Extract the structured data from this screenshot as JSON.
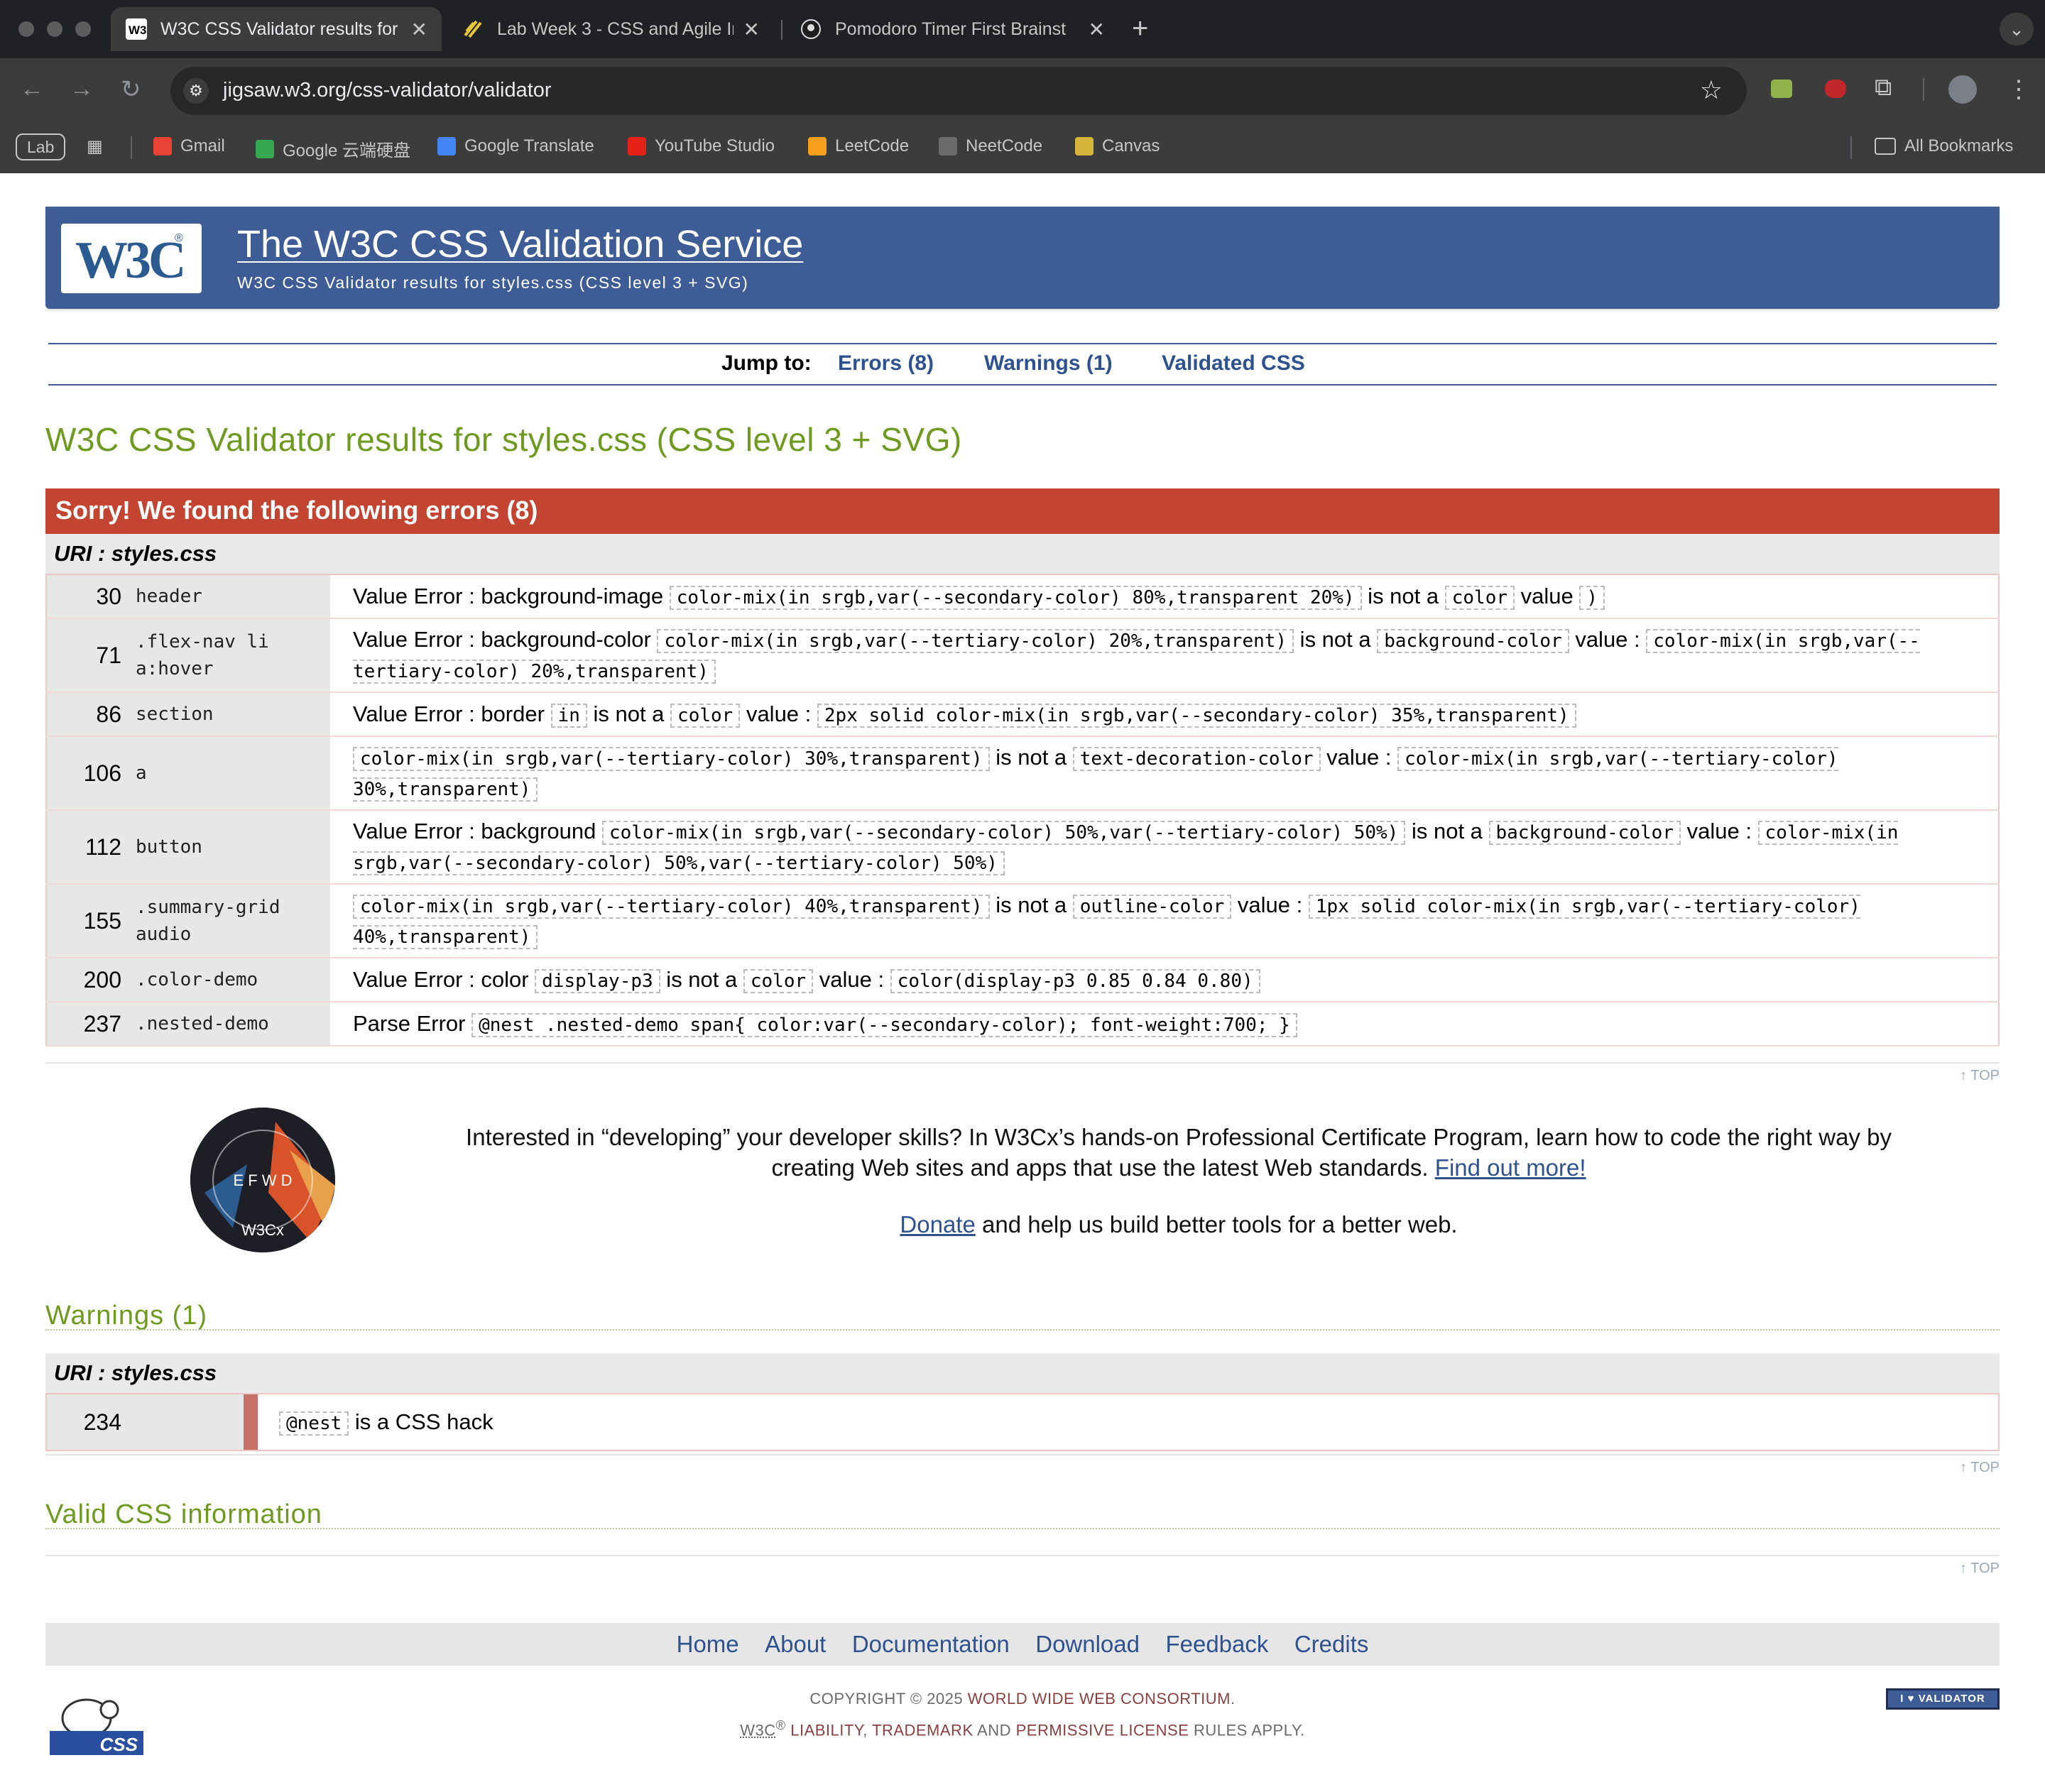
{
  "browser": {
    "tabs": [
      {
        "title": "W3C CSS Validator results for",
        "active": true
      },
      {
        "title": "Lab Week 3 - CSS and Agile In",
        "active": false
      },
      {
        "title": "Pomodoro Timer First Brainst",
        "active": false
      }
    ],
    "url": "jigsaw.w3.org/css-validator/validator",
    "bookmarks": [
      {
        "label": "Gmail"
      },
      {
        "label": "Google 云端硬盘"
      },
      {
        "label": "Google Translate"
      },
      {
        "label": "YouTube Studio"
      },
      {
        "label": "LeetCode"
      },
      {
        "label": "NeetCode"
      },
      {
        "label": "Canvas"
      }
    ],
    "profile_chip": "Lab",
    "all_bookmarks": "All Bookmarks"
  },
  "banner": {
    "logo": "W3C",
    "title": "The W3C CSS Validation Service",
    "subtitle": "W3C CSS Validator results for styles.css (CSS level 3 + SVG)"
  },
  "jump": {
    "label": "Jump to:",
    "errors": "Errors (8)",
    "warnings": "Warnings (1)",
    "validated": "Validated CSS"
  },
  "results_title": "W3C CSS Validator results for styles.css (CSS level 3 + SVG)",
  "errors": {
    "heading": "Sorry! We found the following errors (8)",
    "uri_label": "URI : styles.css",
    "rows": [
      {
        "line": "30",
        "selector": "header",
        "parts": [
          {
            "t": "Value Error : background-image "
          },
          {
            "c": "color-mix(in srgb,var(--secondary-color) 80%,transparent 20%)"
          },
          {
            "t": " is not a "
          },
          {
            "c": "color"
          },
          {
            "t": " value "
          },
          {
            "c": ")"
          }
        ]
      },
      {
        "line": "71",
        "selector": ".flex-nav li a:hover",
        "parts": [
          {
            "t": "Value Error : background-color "
          },
          {
            "c": "color-mix(in srgb,var(--tertiary-color) 20%,transparent)"
          },
          {
            "t": " is not a "
          },
          {
            "c": "background-color"
          },
          {
            "t": " value : "
          },
          {
            "c": "color-mix(in srgb,var(--tertiary-color) 20%,transparent)"
          }
        ]
      },
      {
        "line": "86",
        "selector": "section",
        "parts": [
          {
            "t": "Value Error : border "
          },
          {
            "c": "in"
          },
          {
            "t": " is not a "
          },
          {
            "c": "color"
          },
          {
            "t": " value : "
          },
          {
            "c": "2px solid color-mix(in srgb,var(--secondary-color) 35%,transparent)"
          }
        ]
      },
      {
        "line": "106",
        "selector": "a",
        "parts": [
          {
            "c": "color-mix(in srgb,var(--tertiary-color) 30%,transparent)"
          },
          {
            "t": " is not a "
          },
          {
            "c": "text-decoration-color"
          },
          {
            "t": " value : "
          },
          {
            "c": "color-mix(in srgb,var(--tertiary-color) 30%,transparent)"
          }
        ]
      },
      {
        "line": "112",
        "selector": "button",
        "parts": [
          {
            "t": "Value Error : background "
          },
          {
            "c": "color-mix(in srgb,var(--secondary-color) 50%,var(--tertiary-color) 50%)"
          },
          {
            "t": " is not a "
          },
          {
            "c": "background-color"
          },
          {
            "t": " value : "
          },
          {
            "c": "color-mix(in srgb,var(--secondary-color) 50%,var(--tertiary-color) 50%)"
          }
        ]
      },
      {
        "line": "155",
        "selector": ".summary-grid audio",
        "parts": [
          {
            "c": "color-mix(in srgb,var(--tertiary-color) 40%,transparent)"
          },
          {
            "t": " is not a "
          },
          {
            "c": "outline-color"
          },
          {
            "t": " value : "
          },
          {
            "c": "1px solid color-mix(in srgb,var(--tertiary-color) 40%,transparent)"
          }
        ]
      },
      {
        "line": "200",
        "selector": ".color-demo",
        "parts": [
          {
            "t": "Value Error : color "
          },
          {
            "c": "display-p3"
          },
          {
            "t": " is not a "
          },
          {
            "c": "color"
          },
          {
            "t": " value : "
          },
          {
            "c": "color(display-p3 0.85 0.84 0.80)"
          }
        ]
      },
      {
        "line": "237",
        "selector": ".nested-demo",
        "parts": [
          {
            "t": "Parse Error "
          },
          {
            "c": "@nest .nested-demo span{ color:var(--secondary-color); font-weight:700; }"
          }
        ]
      }
    ]
  },
  "top_label": "↑ TOP",
  "promo": {
    "badge_text": "FRONT END WEB DEVELOPER · W3Cx",
    "text": "Interested in “developing” your developer skills? In W3Cx’s hands-on Professional Certificate Program, learn how to code the right way by creating Web sites and apps that use the latest Web standards.",
    "link": "Find out more!",
    "donate_link": "Donate",
    "donate_text": " and help us build better tools for a better web."
  },
  "warnings": {
    "heading": "Warnings (1)",
    "uri_label": "URI : styles.css",
    "rows": [
      {
        "line": "234",
        "code": "@nest",
        "text": " is a CSS hack"
      }
    ]
  },
  "valid_info": "Valid CSS information",
  "footer": {
    "links": [
      "Home",
      "About",
      "Documentation",
      "Download",
      "Feedback",
      "Credits"
    ],
    "copyright_a": "COPYRIGHT © 2025 ",
    "consortium": "WORLD WIDE WEB CONSORTIUM",
    "w3c": "W3C",
    "reg": "®",
    "liability": "LIABILITY",
    "trademark": "TRADEMARK",
    "and": " AND ",
    "license": "PERMISSIVE LICENSE",
    "rules": " RULES APPLY.",
    "validator_badge": "I ♥ VALIDATOR",
    "css_badge": "CSS"
  },
  "colors": {
    "banner": "#3e5c95",
    "error_header": "#c24431",
    "title_green": "#6d9a1f",
    "link_blue": "#2e5290"
  }
}
